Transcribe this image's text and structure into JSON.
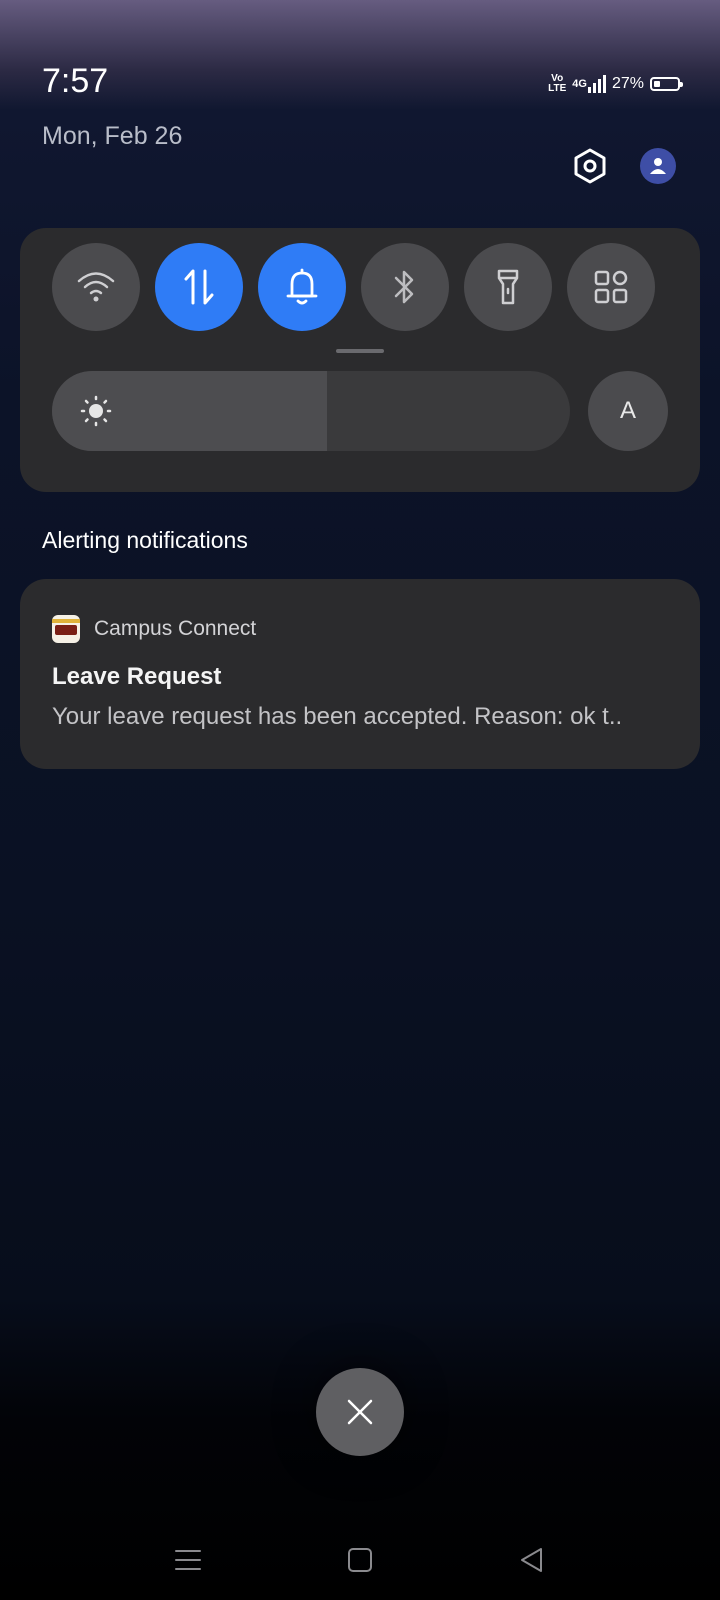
{
  "status_bar": {
    "time": "7:57",
    "volte_label": "Vo\nLTE",
    "network_type": "4G",
    "battery_percent_text": "27%",
    "battery_level": 0.27
  },
  "header": {
    "date": "Mon, Feb 26",
    "settings_icon": "settings-gear-icon",
    "profile_icon": "user-avatar-icon"
  },
  "quick_settings": {
    "tiles": [
      {
        "name": "wifi",
        "icon": "wifi-icon",
        "active": false
      },
      {
        "name": "mobile-data",
        "icon": "data-transfer-icon",
        "active": true
      },
      {
        "name": "sound",
        "icon": "bell-icon",
        "active": true
      },
      {
        "name": "bluetooth",
        "icon": "bluetooth-icon",
        "active": false
      },
      {
        "name": "flashlight",
        "icon": "flashlight-icon",
        "active": false
      },
      {
        "name": "edit-tiles",
        "icon": "grid-icon",
        "active": false
      }
    ],
    "brightness_level": 0.53,
    "auto_brightness_label": "A",
    "active_color": "#2f7cf6"
  },
  "notifications": {
    "section_title": "Alerting notifications",
    "items": [
      {
        "app_name": "Campus Connect",
        "title": "Leave Request",
        "body": "Your leave request has been accepted. Reason: ok t.."
      }
    ]
  },
  "dismiss_icon": "close-icon",
  "nav_bar": {
    "menu_icon": "menu-icon",
    "home_icon": "home-square-icon",
    "back_icon": "back-triangle-icon"
  }
}
